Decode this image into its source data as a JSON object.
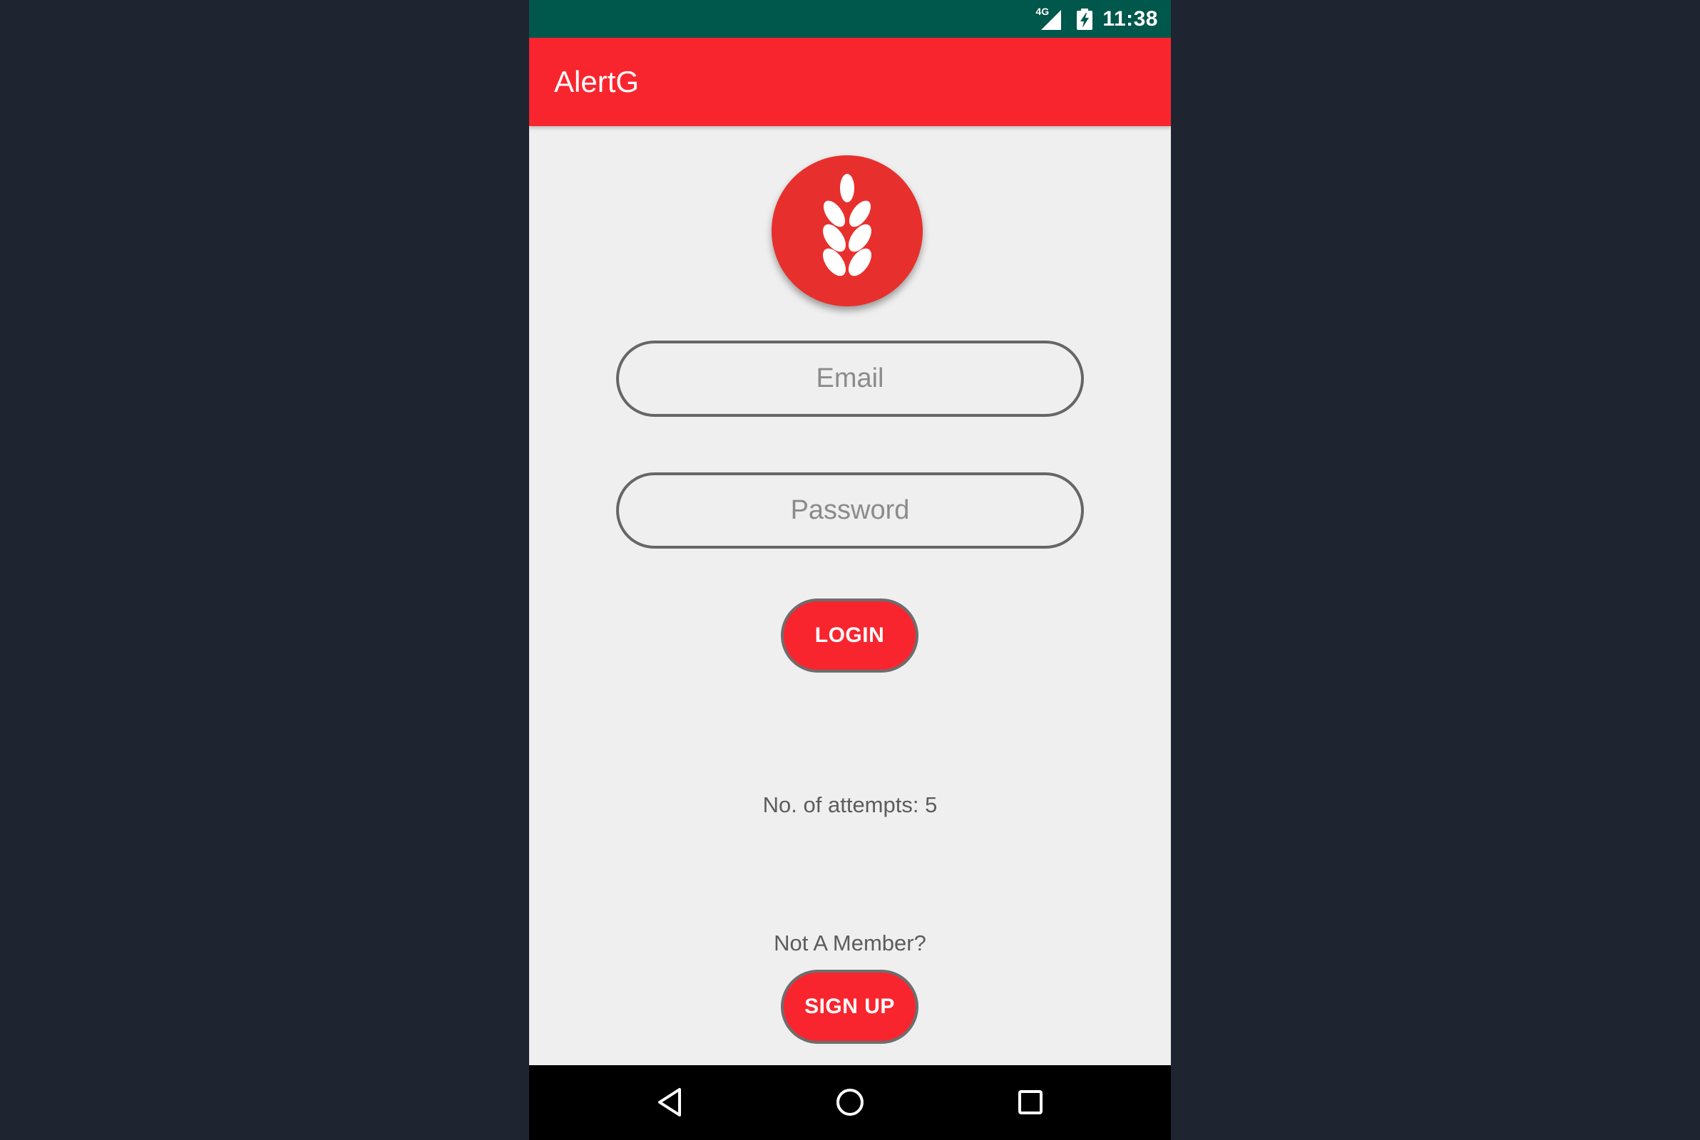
{
  "status_bar": {
    "network_label": "4G",
    "time": "11:38"
  },
  "app_bar": {
    "title": "AlertG"
  },
  "logo": {
    "icon": "wheat-icon",
    "background_color": "#e7302d"
  },
  "form": {
    "email_placeholder": "Email",
    "password_placeholder": "Password",
    "login_label": "LOGIN"
  },
  "attempts_text": "No. of attempts: 5",
  "signup": {
    "prompt": "Not A Member?",
    "button_label": "SIGN UP"
  },
  "nav_bar": {
    "back_icon": "back-triangle-icon",
    "home_icon": "home-circle-icon",
    "recents_icon": "recents-square-icon"
  },
  "colors": {
    "primary": "#f9252e",
    "primary_dark": "#00574b",
    "background": "#efefef",
    "field_border": "#666666"
  }
}
